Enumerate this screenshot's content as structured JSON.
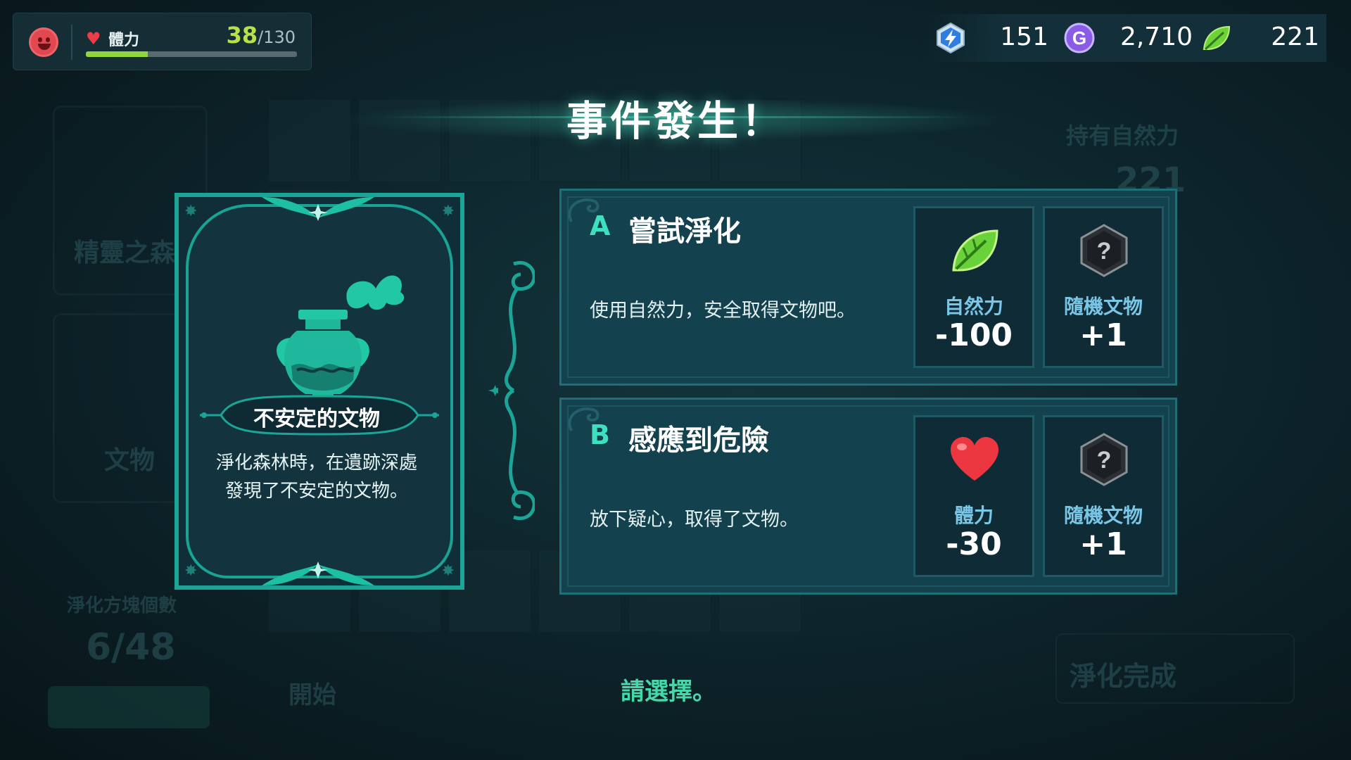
{
  "hud": {
    "hp_label": "體力",
    "hp_current": "38",
    "hp_max": "/130",
    "hp_fraction": 0.292
  },
  "currencies": [
    {
      "name": "energy",
      "icon": "lightning-gem-icon",
      "value": "151"
    },
    {
      "name": "g-coin",
      "icon": "g-coin-icon",
      "value": "2,710"
    },
    {
      "name": "nature-power",
      "icon": "leaf-icon",
      "value": "221"
    }
  ],
  "title": "事件發生！",
  "event_card": {
    "name": "不安定的文物",
    "description_line1": "淨化森林時，在遺跡深處",
    "description_line2": "發現了不安定的文物。"
  },
  "options": [
    {
      "letter": "A",
      "title": "嘗試淨化",
      "description": "使用自然力，安全取得文物吧。",
      "rewards": [
        {
          "icon": "leaf-icon",
          "label": "自然力",
          "value": "-100"
        },
        {
          "icon": "mystery-hexagon-icon",
          "label": "隨機文物",
          "value": "+1"
        }
      ]
    },
    {
      "letter": "B",
      "title": "感應到危險",
      "description": "放下疑心，取得了文物。",
      "rewards": [
        {
          "icon": "heart-icon",
          "label": "體力",
          "value": "-30"
        },
        {
          "icon": "mystery-hexagon-icon",
          "label": "隨機文物",
          "value": "+1"
        }
      ]
    }
  ],
  "prompt": "請選擇。",
  "background": {
    "left_panel_1": "精靈之森",
    "left_panel_2": "文物",
    "purify_count_label": "淨化方塊個數",
    "purify_count": "6/48",
    "start_label": "開始",
    "right_label": "持有自然力",
    "right_value": "221",
    "complete_label": "淨化完成"
  },
  "colors": {
    "accent_teal": "#1aa596",
    "hp_green": "#b8e04a",
    "heart_red": "#ee3d46",
    "reward_label_blue": "#79c6e6",
    "prompt_green": "#46d8a8"
  }
}
